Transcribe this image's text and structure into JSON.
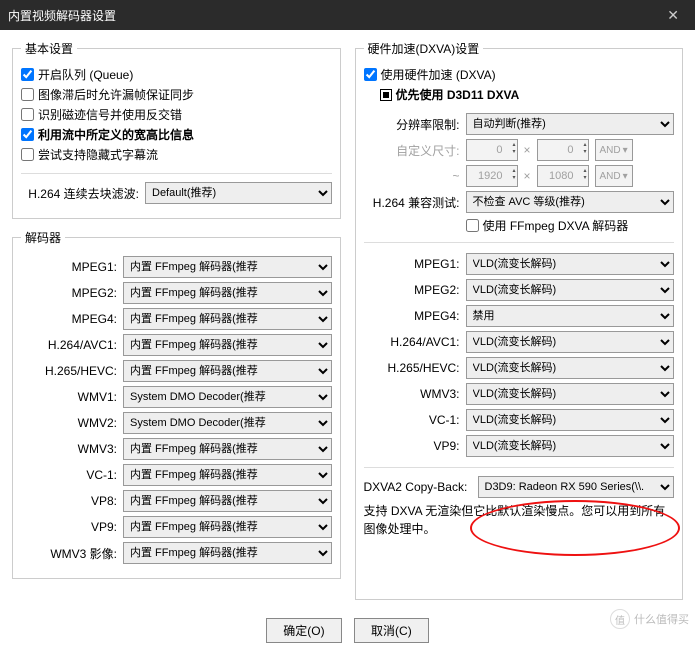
{
  "title": "内置视频解码器设置",
  "left": {
    "basic_legend": "基本设置",
    "chk_queue": "开启队列 (Queue)",
    "chk_dropframe": "图像滞后时允许漏帧保证同步",
    "chk_interlace": "识别磁迹信号并使用反交错",
    "chk_aspect": "利用流中所定义的宽高比信息",
    "chk_subs": "尝试支持隐藏式字幕流",
    "h264_deblock_label": "H.264 连续去块滤波:",
    "h264_deblock_value": "Default(推荐)",
    "decoders_legend": "解码器",
    "rows": [
      {
        "label": "MPEG1:",
        "value": "内置 FFmpeg 解码器(推荐"
      },
      {
        "label": "MPEG2:",
        "value": "内置 FFmpeg 解码器(推荐"
      },
      {
        "label": "MPEG4:",
        "value": "内置 FFmpeg 解码器(推荐"
      },
      {
        "label": "H.264/AVC1:",
        "value": "内置 FFmpeg 解码器(推荐"
      },
      {
        "label": "H.265/HEVC:",
        "value": "内置 FFmpeg 解码器(推荐"
      },
      {
        "label": "WMV1:",
        "value": "System DMO Decoder(推荐"
      },
      {
        "label": "WMV2:",
        "value": "System DMO Decoder(推荐"
      },
      {
        "label": "WMV3:",
        "value": "内置 FFmpeg 解码器(推荐"
      },
      {
        "label": "VC-1:",
        "value": "内置 FFmpeg 解码器(推荐"
      },
      {
        "label": "VP8:",
        "value": "内置 FFmpeg 解码器(推荐"
      },
      {
        "label": "VP9:",
        "value": "内置 FFmpeg 解码器(推荐"
      },
      {
        "label": "WMV3 影像:",
        "value": "内置 FFmpeg 解码器(推荐"
      }
    ]
  },
  "right": {
    "dxva_legend": "硬件加速(DXVA)设置",
    "chk_use_hw": "使用硬件加速 (DXVA)",
    "chk_d3d11": "优先使用 D3D11 DXVA",
    "res_limit_label": "分辨率限制:",
    "res_limit_value": "自动判断(推荐)",
    "custom_label": "自定义尺寸:",
    "custom_w1": "0",
    "custom_h1": "0",
    "and": "AND",
    "tilde": "~",
    "custom_w2": "1920",
    "custom_h2": "1080",
    "h264_compat_label": "H.264 兼容测试:",
    "h264_compat_value": "不检查 AVC 等级(推荐)",
    "chk_ffmpeg_dxva": "使用 FFmpeg DXVA 解码器",
    "rows": [
      {
        "label": "MPEG1:",
        "value": "VLD(流变长解码)"
      },
      {
        "label": "MPEG2:",
        "value": "VLD(流变长解码)"
      },
      {
        "label": "MPEG4:",
        "value": "禁用"
      },
      {
        "label": "H.264/AVC1:",
        "value": "VLD(流变长解码)"
      },
      {
        "label": "H.265/HEVC:",
        "value": "VLD(流变长解码)"
      },
      {
        "label": "WMV3:",
        "value": "VLD(流变长解码)"
      },
      {
        "label": "VC-1:",
        "value": "VLD(流变长解码)"
      },
      {
        "label": "VP9:",
        "value": "VLD(流变长解码)"
      }
    ],
    "copyback_label": "DXVA2 Copy-Back:",
    "copyback_value": "D3D9: Radeon RX 590 Series(\\\\.",
    "note": "支持 DXVA 无渲染但它比默认渲染慢点。您可以用到所有图像处理中。"
  },
  "ok": "确定(O)",
  "cancel": "取消(C)",
  "watermark": "什么值得买",
  "watermark_badge": "值"
}
